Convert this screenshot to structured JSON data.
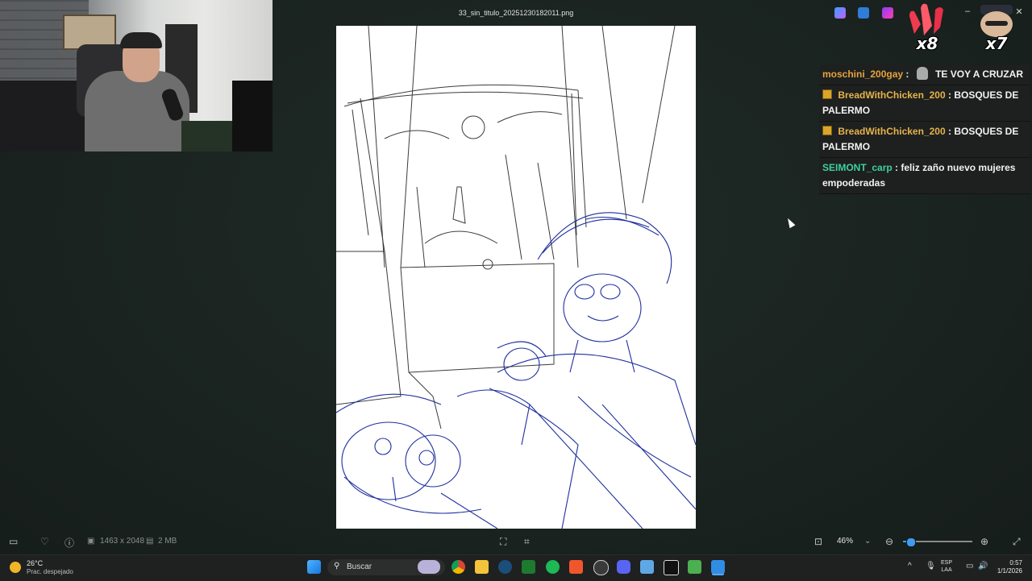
{
  "window": {
    "title": "33_sin_titulo_20251230182011.png",
    "minimize_label": "–",
    "close_label": "✕"
  },
  "chat": {
    "messages": [
      {
        "user": "moschini_200gay",
        "separator": ":",
        "text": "TE VOY A CRUZAR",
        "badge": false
      },
      {
        "user": "BreadWithChicken_200",
        "separator": ":",
        "text": "BOSQUES DE PALERMO",
        "badge": true
      },
      {
        "user": "BreadWithChicken_200",
        "separator": ":",
        "text": "BOSQUES DE PALERMO",
        "badge": true
      },
      {
        "user": "SEIMONT_carp",
        "separator": ":",
        "text": "feliz zaño nuevo mujeres empoderadas",
        "badge": false
      }
    ]
  },
  "reactions": [
    {
      "icon": "clapping-hands-icon",
      "count": "x8"
    },
    {
      "icon": "emote-face-icon",
      "count": "x7"
    }
  ],
  "viewer_bar": {
    "dimensions": "1463 x 2048",
    "file_size": "2 MB",
    "zoom": "46%",
    "zoom_fraction": 0.1
  },
  "taskbar": {
    "weather_temp": "26°C",
    "weather_desc": "Prac. despejado",
    "search_placeholder": "Buscar",
    "lang_top": "ESP",
    "lang_bottom": "LAA",
    "time": "0:57",
    "date": "1/1/2026"
  },
  "colors": {
    "accent": "#3d9cf0",
    "sketch_blue": "#1f2f9e",
    "sketch_black": "#1a1a1a"
  }
}
